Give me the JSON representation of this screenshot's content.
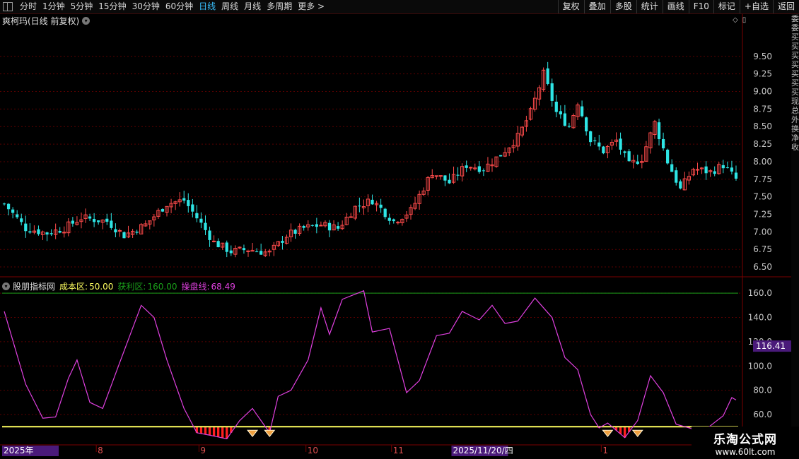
{
  "toolbar": {
    "periods": [
      "分时",
      "1分钟",
      "5分钟",
      "15分钟",
      "30分钟",
      "60分钟",
      "日线",
      "周线",
      "月线",
      "多周期",
      "更多 >"
    ],
    "active_period": "日线",
    "right_tools": [
      "复权",
      "叠加",
      "多股",
      "统计",
      "画线",
      "F10",
      "标记",
      "+自选",
      "返回"
    ]
  },
  "chart_title": "爽柯玛(日线 前复权)",
  "indicator": {
    "name": "股朋指标网",
    "cost_label": "成本区:",
    "cost_value": "50.00",
    "profit_label": "获利区:",
    "profit_value": "160.00",
    "line_label": "操盘线:",
    "line_value": "68.49",
    "current_tag": "116.41"
  },
  "colors": {
    "up": "#ff4b4b",
    "down": "#2ee5e5",
    "grid": "#5a0000",
    "line": "#e040e0",
    "cost": "#ffff60",
    "profit": "#1aa01a",
    "axis_text": "#c8c8c8"
  },
  "price_axis": {
    "min": 6.4,
    "max": 9.8,
    "ticks": [
      "9.50",
      "9.25",
      "9.00",
      "8.75",
      "8.50",
      "8.25",
      "8.00",
      "7.75",
      "7.50",
      "7.25",
      "7.00",
      "6.75",
      "6.50"
    ]
  },
  "ind_axis": {
    "min": 35,
    "max": 170,
    "ticks": [
      "160.0",
      "140.0",
      "120.0",
      "100.0",
      "80.0",
      "60.0"
    ]
  },
  "date_axis": [
    {
      "label": "2025年",
      "pos": 0
    },
    {
      "label": "8",
      "pos": 22
    },
    {
      "label": "9",
      "pos": 46
    },
    {
      "label": "10",
      "pos": 71
    },
    {
      "label": "11",
      "pos": 91
    },
    {
      "label": "2025/11/20/四",
      "pos": 105
    },
    {
      "label": "1",
      "pos": 140
    }
  ],
  "side_text": [
    "委",
    "委",
    "买",
    "买",
    "买",
    "买",
    "买",
    "买",
    "买",
    "现",
    "总",
    "外",
    "换",
    "净",
    "收"
  ],
  "logo": {
    "title": "乐淘公式网",
    "url": "www.60lt.com"
  },
  "chart_data": {
    "type": "line",
    "candles_description_count": 172,
    "close_anchors": [
      [
        0,
        7.4
      ],
      [
        5,
        7.05
      ],
      [
        10,
        6.98
      ],
      [
        14,
        7.05
      ],
      [
        18,
        7.2
      ],
      [
        24,
        7.15
      ],
      [
        28,
        6.95
      ],
      [
        33,
        7.1
      ],
      [
        38,
        7.4
      ],
      [
        42,
        7.45
      ],
      [
        45,
        7.2
      ],
      [
        49,
        6.85
      ],
      [
        53,
        6.72
      ],
      [
        57,
        6.75
      ],
      [
        62,
        6.7
      ],
      [
        66,
        6.95
      ],
      [
        70,
        7.05
      ],
      [
        74,
        7.1
      ],
      [
        78,
        7.05
      ],
      [
        82,
        7.35
      ],
      [
        86,
        7.45
      ],
      [
        91,
        7.15
      ],
      [
        95,
        7.3
      ],
      [
        100,
        7.85
      ],
      [
        104,
        7.7
      ],
      [
        108,
        7.95
      ],
      [
        112,
        7.9
      ],
      [
        116,
        8.1
      ],
      [
        120,
        8.35
      ],
      [
        123,
        8.7
      ],
      [
        126,
        9.25
      ],
      [
        129,
        8.7
      ],
      [
        132,
        8.5
      ],
      [
        134,
        8.85
      ],
      [
        137,
        8.3
      ],
      [
        140,
        8.15
      ],
      [
        143,
        8.3
      ],
      [
        146,
        7.95
      ],
      [
        149,
        8.05
      ],
      [
        152,
        8.55
      ],
      [
        155,
        8.0
      ],
      [
        158,
        7.6
      ],
      [
        161,
        7.9
      ],
      [
        165,
        7.85
      ],
      [
        168,
        7.95
      ],
      [
        171,
        7.75
      ]
    ],
    "indicator_anchors": [
      [
        0,
        145
      ],
      [
        5,
        85
      ],
      [
        9,
        57
      ],
      [
        12,
        58
      ],
      [
        15,
        90
      ],
      [
        17,
        105
      ],
      [
        20,
        70
      ],
      [
        23,
        65
      ],
      [
        27,
        103
      ],
      [
        32,
        150
      ],
      [
        35,
        140
      ],
      [
        38,
        105
      ],
      [
        42,
        65
      ],
      [
        45,
        45
      ],
      [
        48,
        43
      ],
      [
        52,
        40
      ],
      [
        55,
        55
      ],
      [
        58,
        65
      ],
      [
        62,
        45
      ],
      [
        64,
        75
      ],
      [
        67,
        80
      ],
      [
        71,
        105
      ],
      [
        74,
        148
      ],
      [
        76,
        126
      ],
      [
        79,
        155
      ],
      [
        84,
        162
      ],
      [
        86,
        128
      ],
      [
        90,
        131
      ],
      [
        94,
        78
      ],
      [
        97,
        88
      ],
      [
        101,
        125
      ],
      [
        104,
        127
      ],
      [
        107,
        145
      ],
      [
        111,
        138
      ],
      [
        114,
        150
      ],
      [
        117,
        135
      ],
      [
        120,
        137
      ],
      [
        124,
        156
      ],
      [
        128,
        140
      ],
      [
        131,
        107
      ],
      [
        134,
        97
      ],
      [
        137,
        60
      ],
      [
        139,
        49
      ],
      [
        141,
        53
      ],
      [
        145,
        41
      ],
      [
        148,
        55
      ],
      [
        151,
        92
      ],
      [
        154,
        78
      ],
      [
        157,
        52
      ],
      [
        161,
        48
      ],
      [
        164,
        48
      ],
      [
        168,
        59
      ],
      [
        170,
        74
      ],
      [
        172,
        70
      ]
    ],
    "cost_line": 50,
    "profit_line": 160,
    "buy_signal_indices": [
      58,
      62,
      141,
      148,
      163
    ]
  }
}
